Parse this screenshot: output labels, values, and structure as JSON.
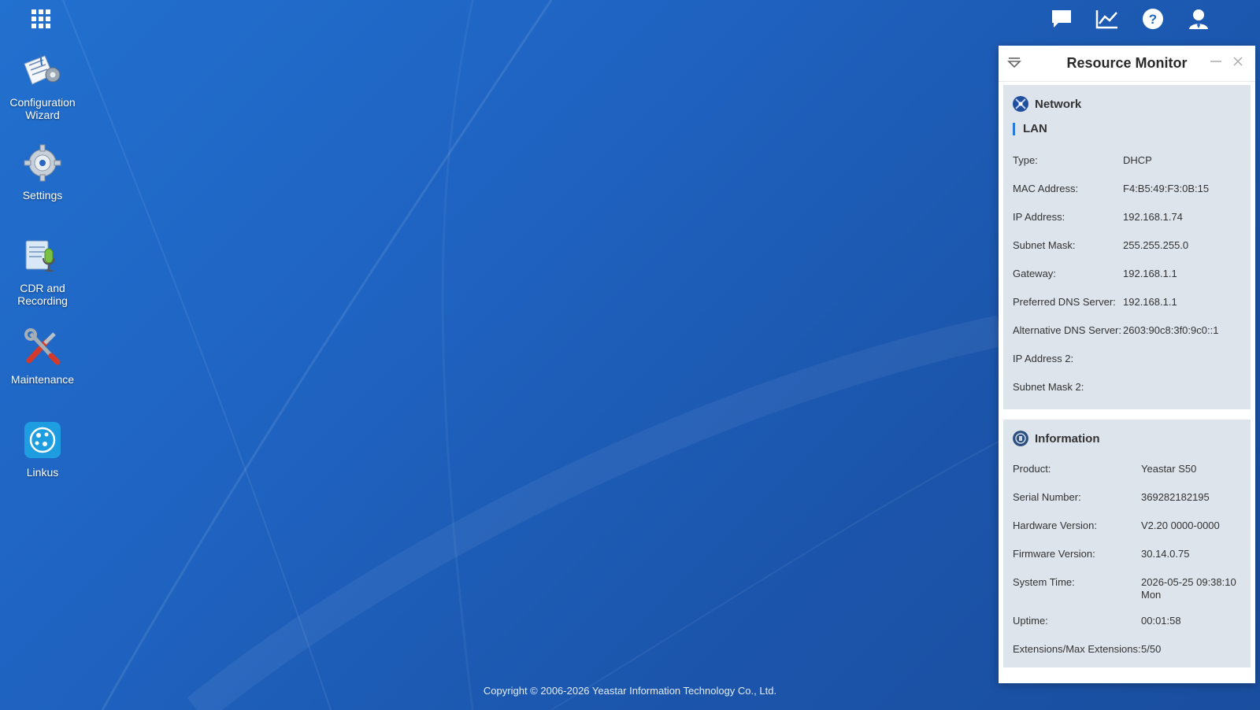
{
  "desktop": {
    "icons": [
      {
        "label": "Configuration Wizard",
        "icon": "wizard-icon"
      },
      {
        "label": "Settings",
        "icon": "gear-icon"
      },
      {
        "label": "CDR and Recording",
        "icon": "recording-icon"
      },
      {
        "label": "Maintenance",
        "icon": "tools-icon"
      },
      {
        "label": "Linkus",
        "icon": "linkus-icon"
      }
    ]
  },
  "topbar": {
    "icons": [
      "chat-icon",
      "chart-icon",
      "help-icon",
      "user-icon"
    ]
  },
  "monitor": {
    "title": "Resource Monitor",
    "network": {
      "title": "Network",
      "lan_label": "LAN",
      "rows": [
        {
          "key": "Type:",
          "value": "DHCP"
        },
        {
          "key": "MAC Address:",
          "value": "F4:B5:49:F3:0B:15"
        },
        {
          "key": "IP Address:",
          "value": "192.168.1.74"
        },
        {
          "key": "Subnet Mask:",
          "value": "255.255.255.0"
        },
        {
          "key": "Gateway:",
          "value": "192.168.1.1"
        },
        {
          "key": "Preferred DNS Server:",
          "value": "192.168.1.1"
        },
        {
          "key": "Alternative DNS Server:",
          "value": "2603:90c8:3f0:9c0::1"
        },
        {
          "key": "IP Address 2:",
          "value": ""
        },
        {
          "key": "Subnet Mask 2:",
          "value": ""
        }
      ]
    },
    "information": {
      "title": "Information",
      "rows": [
        {
          "key": "Product:",
          "value": "Yeastar S50"
        },
        {
          "key": "Serial Number:",
          "value": "369282182195"
        },
        {
          "key": "Hardware Version:",
          "value": "V2.20 0000-0000"
        },
        {
          "key": "Firmware Version:",
          "value": "30.14.0.75"
        },
        {
          "key": "System Time:",
          "value": "2026-05-25 09:38:10 Mon"
        },
        {
          "key": "Uptime:",
          "value": "00:01:58"
        },
        {
          "key": "Extensions/Max Extensions:",
          "value": "5/50"
        }
      ]
    }
  },
  "footer": {
    "text": "Copyright © 2006-2026 Yeastar Information Technology Co., Ltd."
  },
  "colors": {
    "accent": "#2b7ad9",
    "panel_section": "#dde4ec"
  }
}
